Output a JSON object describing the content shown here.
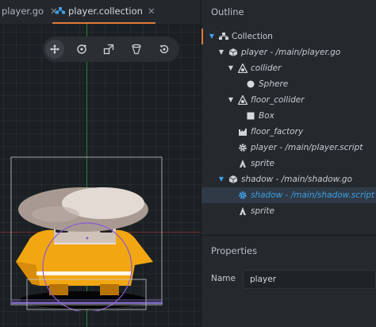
{
  "tabs": [
    {
      "label": "player.go",
      "close": "✕"
    },
    {
      "label": "player.collection",
      "close": "✕",
      "active": true
    }
  ],
  "toolbar": {
    "tools": [
      "move-icon",
      "rotate-icon",
      "scale-icon",
      "perspective-icon",
      "camera-reset-icon"
    ],
    "active_tool": "move-icon"
  },
  "outline": {
    "title": "Outline",
    "items": [
      {
        "label": "Collection",
        "icon": "collection-icon",
        "depth": 0,
        "expander": "▼"
      },
      {
        "label": "player - /main/player.go",
        "icon": "game-object-icon",
        "depth": 1,
        "expander": "▼"
      },
      {
        "label": "collider",
        "icon": "collision-icon",
        "depth": 2,
        "expander": "▼"
      },
      {
        "label": "Sphere",
        "icon": "sphere-icon",
        "depth": 3
      },
      {
        "label": "floor_collider",
        "icon": "collision-icon",
        "depth": 2,
        "expander": "▼"
      },
      {
        "label": "Box",
        "icon": "box-icon",
        "depth": 3
      },
      {
        "label": "floor_factory",
        "icon": "factory-icon",
        "depth": 2
      },
      {
        "label": "player - /main/player.script",
        "icon": "script-gear-icon",
        "depth": 2
      },
      {
        "label": "sprite",
        "icon": "sprite-icon",
        "depth": 2
      },
      {
        "label": "shadow - /main/shadow.go",
        "icon": "game-object-icon",
        "depth": 1,
        "expander": "▼"
      },
      {
        "label": "shadow - /main/shadow.script",
        "icon": "script-gear-icon",
        "depth": 2,
        "selected": true
      },
      {
        "label": "sprite",
        "icon": "sprite-icon",
        "depth": 2
      }
    ]
  },
  "properties": {
    "title": "Properties",
    "name_label": "Name",
    "name_value": "player"
  },
  "colors": {
    "accent_orange": "#e07a3a",
    "selection_blue": "#3ea0e6",
    "panel_bg": "#25292e",
    "scene_bg": "#1b2024"
  }
}
